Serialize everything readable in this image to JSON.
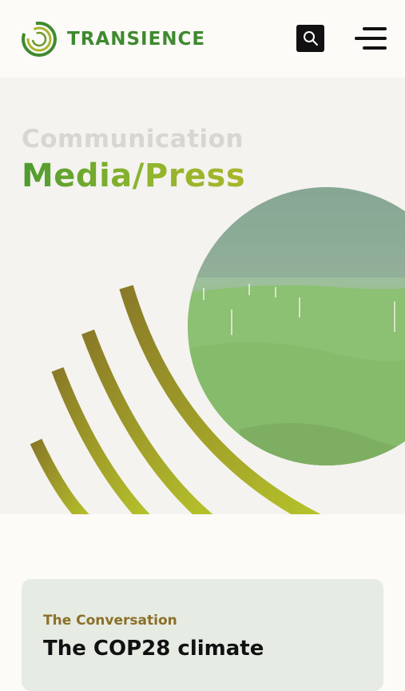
{
  "header": {
    "logo_text": "TRANSIENCE",
    "search_icon": "search-icon",
    "menu_icon": "hamburger-menu-icon"
  },
  "hero": {
    "eyebrow": "Communication",
    "title": "Media/Press"
  },
  "card": {
    "source": "The Conversation",
    "title": "The COP28 climate"
  },
  "colors": {
    "brand_green": "#3f8a2f",
    "accent_olive": "#a8b52a",
    "card_bg": "#e6ebe3",
    "source_text": "#8a7028"
  }
}
